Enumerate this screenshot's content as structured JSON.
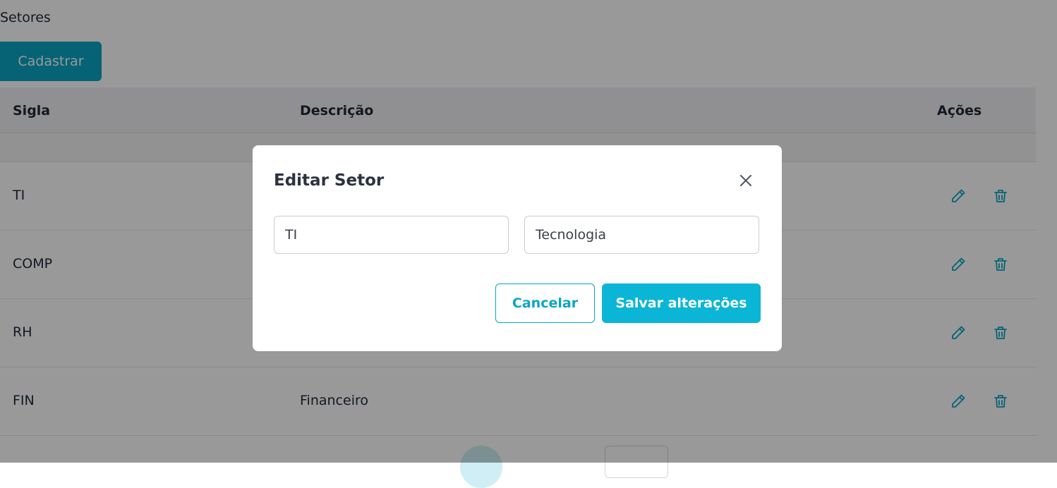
{
  "page": {
    "title": "Setores",
    "register_label": "Cadastrar"
  },
  "table": {
    "headers": {
      "sigla": "Sigla",
      "descricao": "Descrição",
      "acoes": "Ações"
    },
    "rows": [
      {
        "sigla": "TI",
        "descricao": ""
      },
      {
        "sigla": "COMP",
        "descricao": ""
      },
      {
        "sigla": "RH",
        "descricao": ""
      },
      {
        "sigla": "FIN",
        "descricao": "Financeiro"
      }
    ],
    "row_actions": [
      "pencil-icon",
      "trash-icon"
    ]
  },
  "modal": {
    "title": "Editar Setor",
    "close_icon": "close-icon",
    "fields": {
      "sigla_value": "TI",
      "descricao_value": "Tecnologia"
    },
    "cancel_label": "Cancelar",
    "save_label": "Salvar alterações"
  },
  "colors": {
    "accent": "#0aa6c3",
    "overlay": "rgba(0,0,0,0.4)"
  }
}
